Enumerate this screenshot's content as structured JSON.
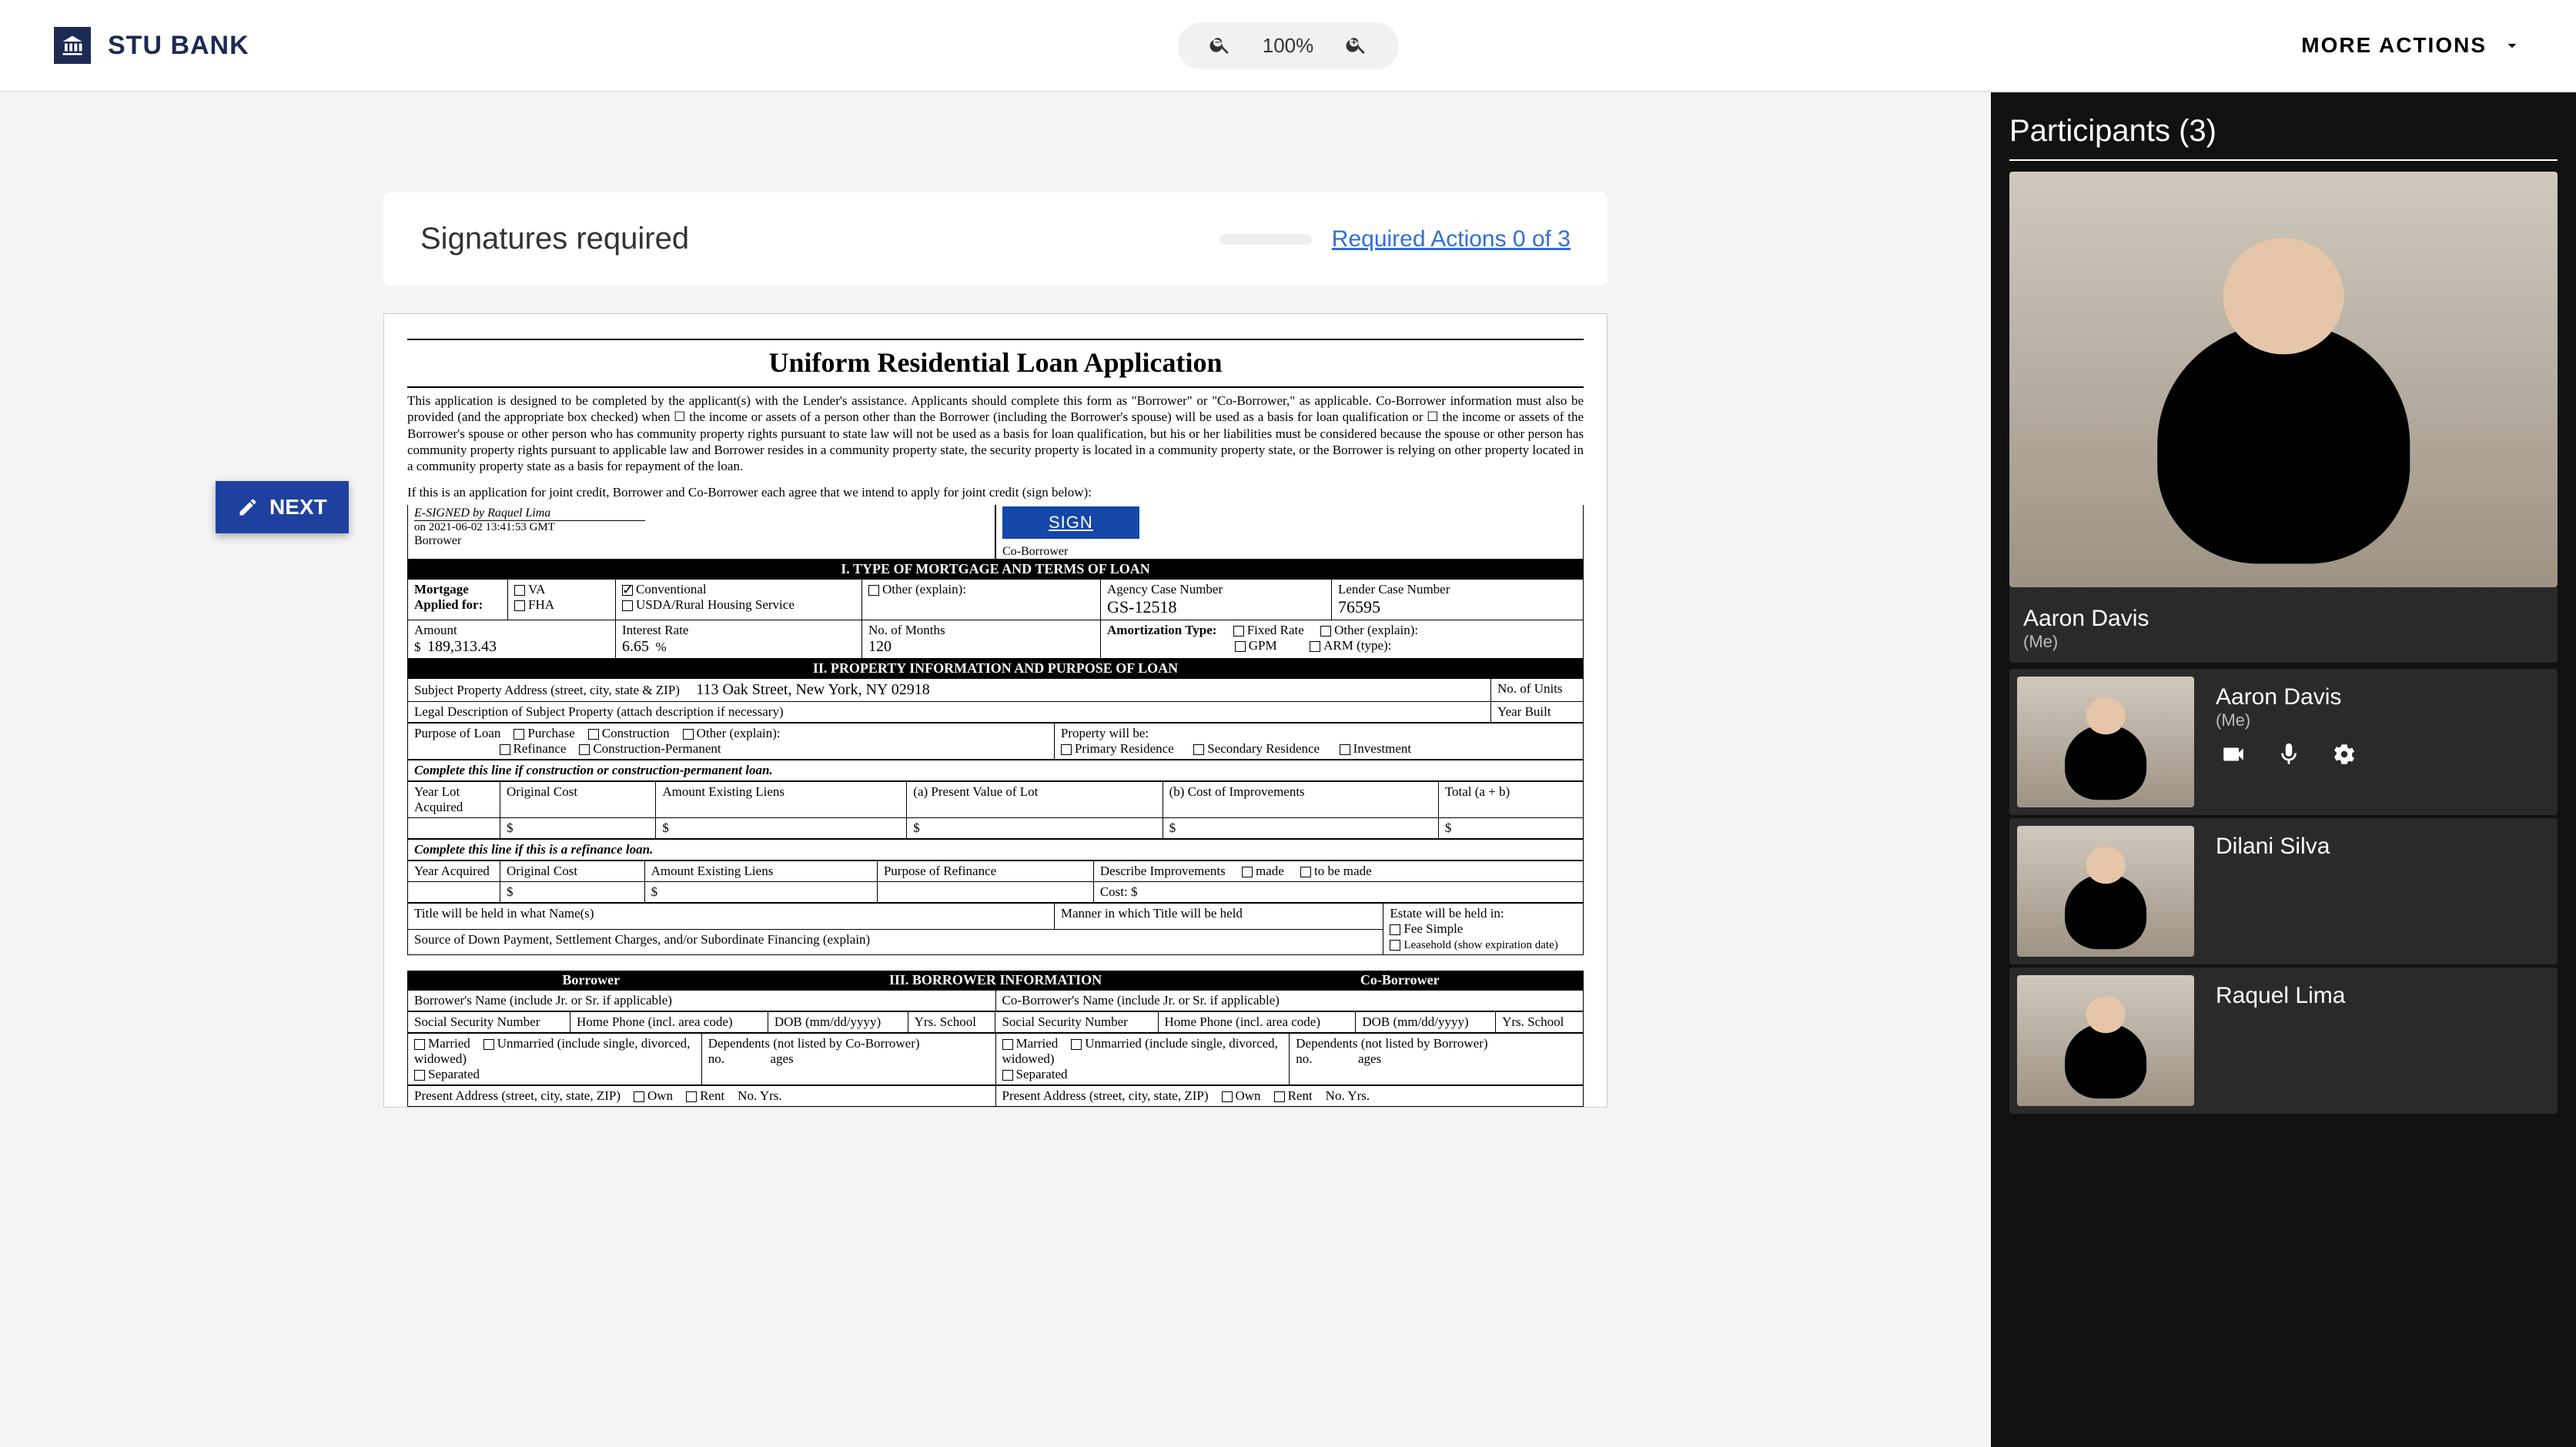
{
  "brand": "STU BANK",
  "zoom": {
    "out_icon": "zoom-out",
    "in_icon": "zoom-in",
    "level": "100%"
  },
  "more_actions": "MORE ACTIONS",
  "next_button": "NEXT",
  "panel": {
    "title": "Signatures required",
    "link": "Required Actions 0 of 3"
  },
  "doc": {
    "title": "Uniform Residential Loan Application",
    "intro": "This application is designed to be completed by the applicant(s) with the Lender's assistance. Applicants should complete this form as \"Borrower\" or \"Co-Borrower,\" as applicable. Co-Borrower information must also be provided (and the appropriate box checked) when ☐ the income or assets of a person other than the Borrower (including the Borrower's spouse) will be used as a basis for loan qualification or ☐ the income or assets of the Borrower's spouse or other person who has community property rights pursuant to state law will not be used as a basis for loan qualification, but his or her liabilities must be considered because the spouse or other person has community property rights pursuant to applicable law and Borrower resides in a community property state, the security property is located in a community property state, or the Borrower is relying on other property located in a community property state as a basis for repayment of the loan.",
    "joint": "If this is an application for joint credit, Borrower and Co-Borrower each agree that we intend to apply for joint credit (sign below):",
    "borrower_label": "Borrower",
    "coborrower_label": "Co-Borrower",
    "esigned_line1": "E-SIGNED by Raquel Lima",
    "esigned_line2": "on 2021-06-02 13:41:53 GMT",
    "sign_button": "SIGN",
    "sec1": "I. TYPE OF MORTGAGE AND TERMS OF LOAN",
    "mortgage_applied": "Mortgage Applied for:",
    "va": "VA",
    "conventional": "Conventional",
    "other_explain": "Other (explain):",
    "fha": "FHA",
    "usda": "USDA/Rural Housing Service",
    "agency": "Agency Case Number",
    "agency_val": "GS-12518",
    "lender": "Lender Case Number",
    "lender_val": "76595",
    "amount": "Amount",
    "amount_val": "189,313.43",
    "rate": "Interest Rate",
    "rate_val": "6.65",
    "months": "No. of Months",
    "months_val": "120",
    "amort": "Amortization Type:",
    "fixed": "Fixed Rate",
    "other2": "Other (explain):",
    "gpm": "GPM",
    "arm": "ARM (type):",
    "sec2": "II. PROPERTY INFORMATION AND PURPOSE OF LOAN",
    "addr_label": "Subject Property Address (street, city, state & ZIP)",
    "addr_val": "113 Oak Street, New York, NY 02918",
    "units": "No. of Units",
    "legal": "Legal Description of Subject Property (attach description if necessary)",
    "year_built": "Year Built",
    "purpose": "Purpose of Loan",
    "purchase": "Purchase",
    "construction": "Construction",
    "refinance": "Refinance",
    "constr_perm": "Construction-Permanent",
    "prop_will": "Property will be:",
    "primary": "Primary Residence",
    "secondary": "Secondary Residence",
    "investment": "Investment",
    "constr_line": "Complete this line if construction or construction-permanent loan.",
    "year_lot": "Year Lot Acquired",
    "orig_cost": "Original Cost",
    "amt_liens": "Amount Existing Liens",
    "present_val": "(a) Present Value of Lot",
    "cost_impr": "(b) Cost of Improvements",
    "total_ab": "Total (a + b)",
    "refi_line": "Complete this line if this is a refinance loan.",
    "year_acq": "Year Acquired",
    "purpose_refi": "Purpose of Refinance",
    "desc_impr": "Describe Improvements",
    "made": "made",
    "tobemade": "to be made",
    "cost": "Cost: $",
    "title_names": "Title will be held in what Name(s)",
    "manner_title": "Manner in which Title will be held",
    "estate_held": "Estate will be held in:",
    "fee_simple": "Fee Simple",
    "leasehold": "Leasehold (show expiration date)",
    "source_down": "Source of Down Payment, Settlement Charges, and/or Subordinate Financing (explain)",
    "sec3_b": "Borrower",
    "sec3": "III. BORROWER INFORMATION",
    "sec3_c": "Co-Borrower",
    "bname": "Borrower's Name (include Jr. or Sr. if applicable)",
    "cname": "Co-Borrower's Name (include Jr. or Sr. if applicable)",
    "ssn": "Social Security Number",
    "home_phone": "Home Phone (incl. area code)",
    "dob": "DOB (mm/dd/yyyy)",
    "yrs_school": "Yrs. School",
    "married": "Married",
    "unmarried": "Unmarried (include single, divorced, widowed)",
    "separated": "Separated",
    "dependents_b": "Dependents (not listed by Co-Borrower)",
    "dependents_c": "Dependents (not listed by Borrower)",
    "dep_no": "no.",
    "dep_ages": "ages",
    "present_addr": "Present Address (street, city, state, ZIP)",
    "own": "Own",
    "rent": "Rent",
    "no_yrs": "No. Yrs."
  },
  "sidebar": {
    "title": "Participants (3)",
    "p": [
      {
        "name": "Aaron Davis",
        "me": "(Me)"
      },
      {
        "name": "Aaron Davis",
        "me": "(Me)"
      },
      {
        "name": "Dilani Silva",
        "me": ""
      },
      {
        "name": "Raquel Lima",
        "me": ""
      }
    ]
  }
}
